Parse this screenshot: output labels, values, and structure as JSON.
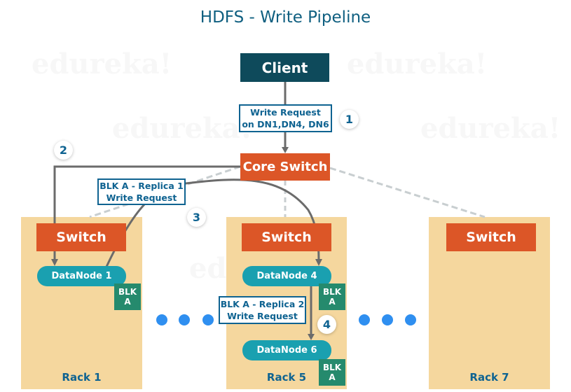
{
  "title": "HDFS - Write Pipeline",
  "watermark": "edureka!",
  "client": {
    "label": "Client"
  },
  "core_switch": {
    "label": "Core Switch"
  },
  "callouts": {
    "write_request": {
      "line1": "Write Request",
      "line2": "on DN1,DN4, DN6"
    },
    "replica1": {
      "line1": "BLK A - Replica 1",
      "line2": "Write Request"
    },
    "replica2": {
      "line1": "BLK A - Replica 2",
      "line2": "Write Request"
    }
  },
  "steps": [
    "1",
    "2",
    "3",
    "4"
  ],
  "racks": [
    {
      "label": "Rack 1",
      "switch_label": "Switch",
      "datanodes": [
        {
          "label": "DataNode 1",
          "block": {
            "line1": "BLK",
            "line2": "A"
          }
        }
      ]
    },
    {
      "label": "Rack 5",
      "switch_label": "Switch",
      "datanodes": [
        {
          "label": "DataNode 4",
          "block": {
            "line1": "BLK",
            "line2": "A"
          }
        },
        {
          "label": "DataNode 6",
          "block": {
            "line1": "BLK",
            "line2": "A"
          }
        }
      ]
    },
    {
      "label": "Rack 7",
      "switch_label": "Switch",
      "datanodes": []
    }
  ],
  "colors": {
    "title": "#0f5f80",
    "client": "#0e4a5b",
    "switch": "#dc5627",
    "rack": "#f5d79e",
    "datanode": "#1aa0b0",
    "block": "#258a6d",
    "callout_border": "#0f6391",
    "ellipsis_dot": "#2f8ff0",
    "arrow": "#6b6b6b"
  }
}
